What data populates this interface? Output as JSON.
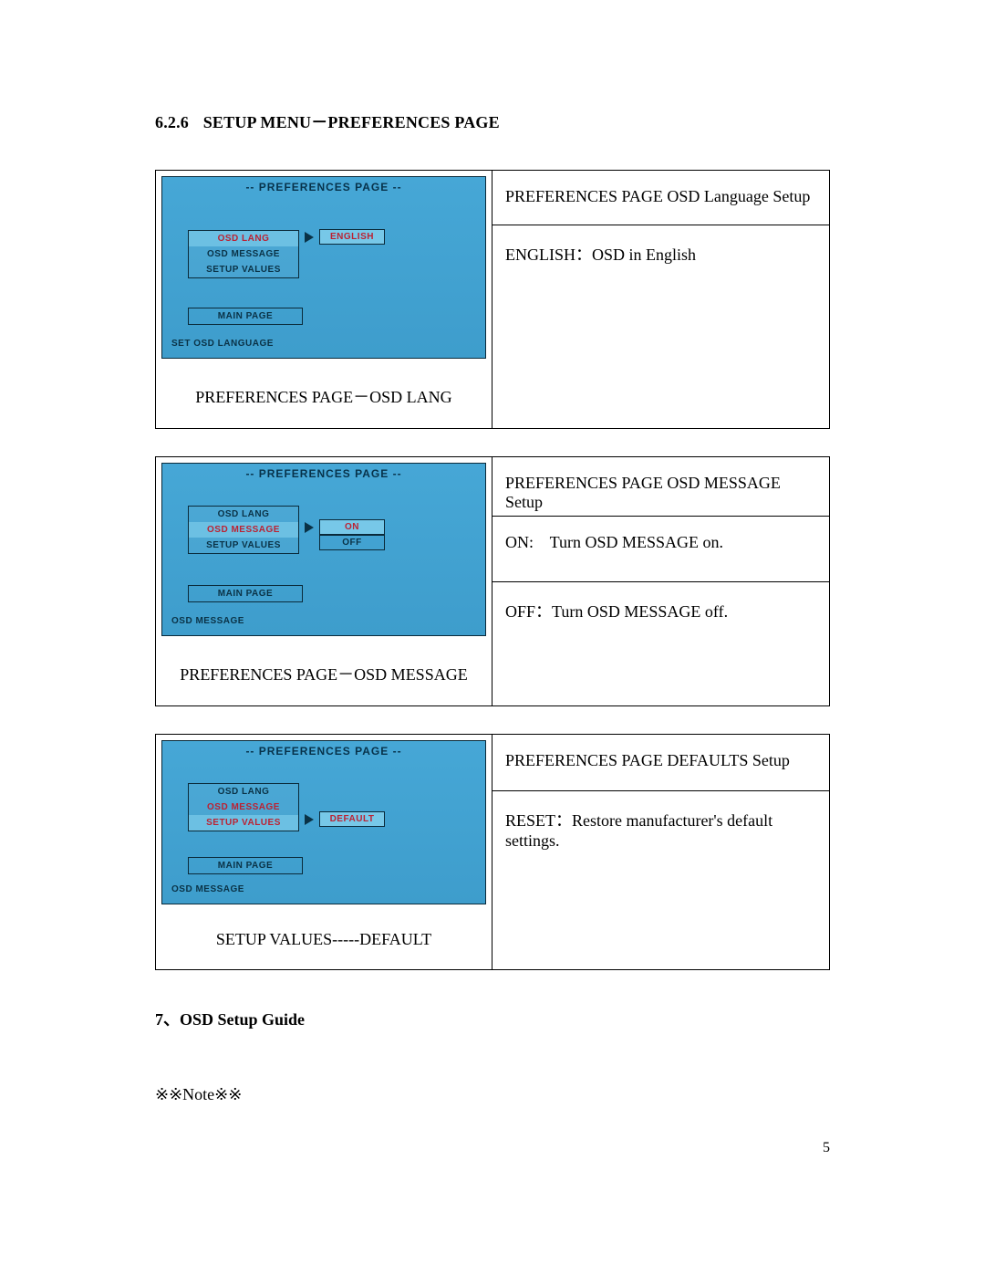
{
  "heading": {
    "num": "6.2.6",
    "title": "SETUP MENU－PREFERENCES PAGE"
  },
  "osd_common": {
    "title": "-- PREFERENCES PAGE --",
    "items": {
      "lang": "OSD LANG",
      "msg": "OSD MESSAGE",
      "setup": "SETUP VALUES"
    },
    "main": "MAIN PAGE"
  },
  "block1": {
    "status": "SET OSD LANGUAGE",
    "option": "ENGLISH",
    "caption": "PREFERENCES PAGE－OSD LANG",
    "r1": "PREFERENCES PAGE OSD Language Setup",
    "r2": "ENGLISH：OSD in English"
  },
  "block2": {
    "status": "OSD MESSAGE",
    "opt_on": "ON",
    "opt_off": "OFF",
    "caption": "PREFERENCES PAGE－OSD MESSAGE",
    "r1": "PREFERENCES PAGE OSD MESSAGE Setup",
    "r2": "ON:    Turn OSD MESSAGE on.",
    "r3": "OFF：Turn OSD MESSAGE off."
  },
  "block3": {
    "status": "OSD MESSAGE",
    "option": "DEFAULT",
    "caption": "SETUP VALUES-----DEFAULT",
    "r1": "PREFERENCES PAGE DEFAULTS Setup",
    "r2": "RESET：Restore manufacturer's default settings."
  },
  "heading2": "7、OSD Setup Guide",
  "note": "※※Note※※",
  "page_num": "5"
}
